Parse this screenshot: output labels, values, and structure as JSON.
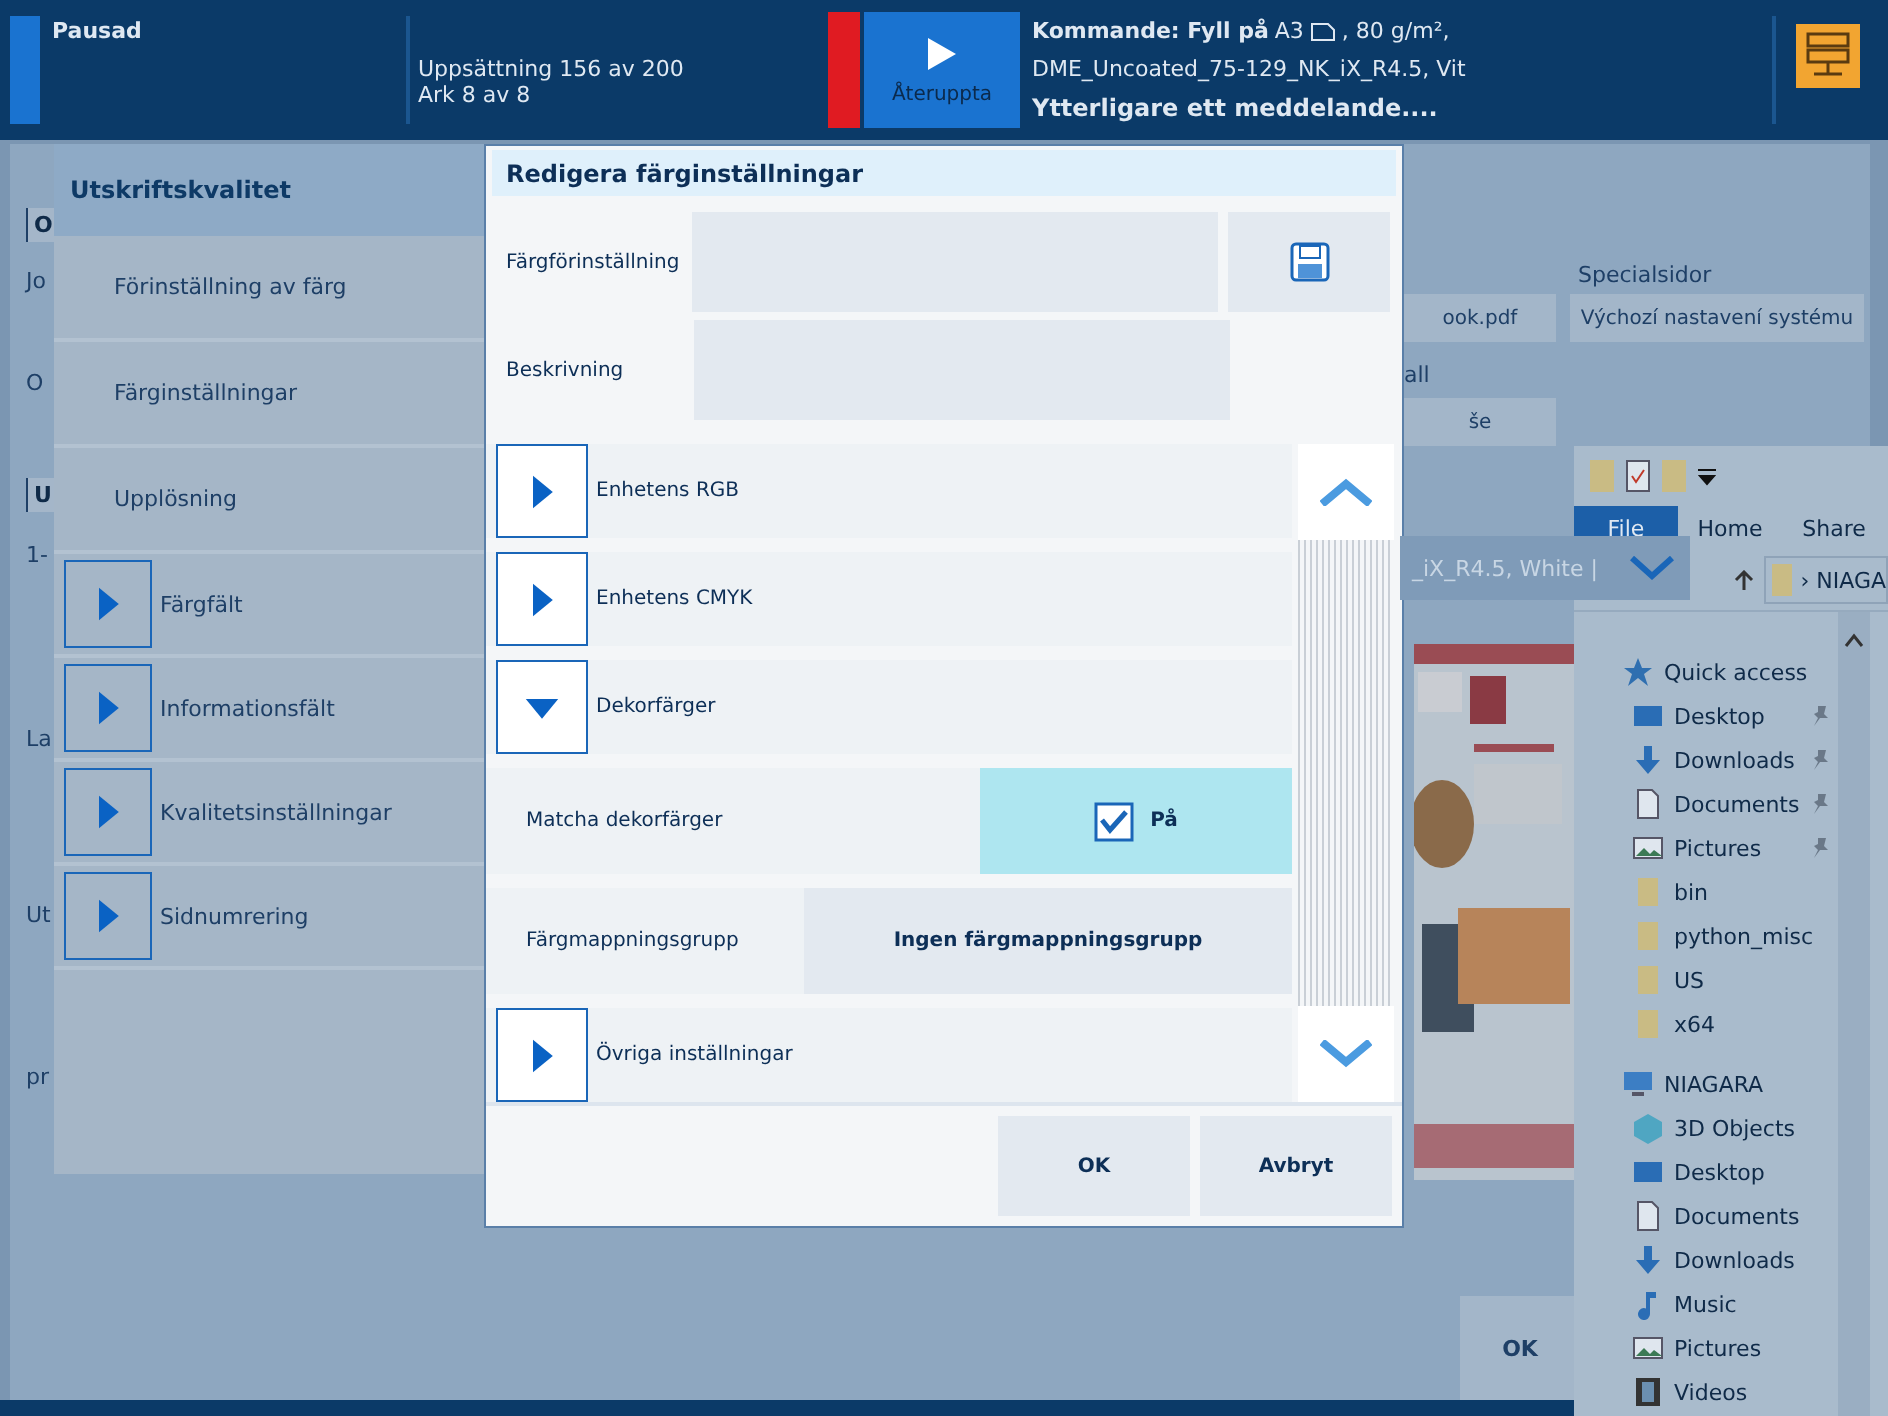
{
  "status_bar": {
    "state": "Pausad",
    "progress_lines": [
      "Uppsättning 156 av 200",
      "Ark 8 av 8"
    ],
    "resume_button": "Återuppta",
    "next_label": "Kommande: Fyll på",
    "next_size": "A3",
    "next_weight": ", 80 g/m²,",
    "next_media": "DME_Uncoated_75-129_NK_iX_R4.5, Vit",
    "message": "Ytterligare ett meddelande...."
  },
  "background": {
    "fragments": [
      {
        "text": "O",
        "kind": "tab"
      },
      {
        "text": "Jo",
        "kind": "label"
      },
      {
        "text": "O",
        "kind": "label"
      },
      {
        "text": "U",
        "kind": "tab"
      },
      {
        "text": "1-",
        "kind": "label"
      },
      {
        "text": "La",
        "kind": "label"
      },
      {
        "text": "Ut",
        "kind": "label"
      },
      {
        "text": "pr",
        "kind": "label"
      }
    ],
    "file_value": "ook.pdf",
    "special_label": "Specialsidor",
    "special_value": "Výchozí nastavení systému",
    "fragment_all": "all",
    "fragment_se": "še",
    "media_dropdown": "_iX_R4.5, White |",
    "ok_button": "OK"
  },
  "quality_panel": {
    "title": "Utskriftskvalitet",
    "items": [
      {
        "label": "Förinställning av färg",
        "kind": "plain"
      },
      {
        "label": "Färginställningar",
        "kind": "plain"
      },
      {
        "label": "Upplösning",
        "kind": "plain"
      },
      {
        "label": "Färgfält",
        "kind": "expander"
      },
      {
        "label": "Informationsfält",
        "kind": "expander"
      },
      {
        "label": "Kvalitetsinställningar",
        "kind": "expander"
      },
      {
        "label": "Sidnumrering",
        "kind": "expander"
      }
    ]
  },
  "dialog": {
    "title": "Redigera färginställningar",
    "preset_label": "Färgförinställning",
    "description_label": "Beskrivning",
    "sections": [
      {
        "label": "Enhetens RGB",
        "expanded": false
      },
      {
        "label": "Enhetens CMYK",
        "expanded": false
      },
      {
        "label": "Dekorfärger",
        "expanded": true,
        "settings": [
          {
            "kind": "toggle",
            "label": "Matcha dekorfärger",
            "value": "På",
            "checked": true
          },
          {
            "kind": "select",
            "label": "Färgmappningsgrupp",
            "value": "Ingen färgmappningsgrupp"
          }
        ]
      },
      {
        "label": "Övriga inställningar",
        "expanded": false
      }
    ],
    "buttons": [
      "OK",
      "Avbryt"
    ]
  },
  "explorer": {
    "tabs": [
      {
        "label": "File",
        "selected": true
      },
      {
        "label": "Home",
        "selected": false
      },
      {
        "label": "Share",
        "selected": false
      }
    ],
    "address_separator": "›",
    "address": "NIAGA",
    "nav": [
      {
        "label": "Quick access",
        "kind": "star",
        "children": [
          {
            "label": "Desktop",
            "kind": "desktop",
            "pinned": true
          },
          {
            "label": "Downloads",
            "kind": "download",
            "pinned": true
          },
          {
            "label": "Documents",
            "kind": "document",
            "pinned": true
          },
          {
            "label": "Pictures",
            "kind": "pictures",
            "pinned": true
          },
          {
            "label": "bin",
            "kind": "folder",
            "pinned": false
          },
          {
            "label": "python_misc",
            "kind": "folder",
            "pinned": false
          },
          {
            "label": "US",
            "kind": "folder",
            "pinned": false
          },
          {
            "label": "x64",
            "kind": "folder",
            "pinned": false
          }
        ]
      },
      {
        "label": "NIAGARA",
        "kind": "computer",
        "children": [
          {
            "label": "3D Objects",
            "kind": "cube",
            "pinned": false
          },
          {
            "label": "Desktop",
            "kind": "desktop",
            "pinned": false
          },
          {
            "label": "Documents",
            "kind": "document",
            "pinned": false
          },
          {
            "label": "Downloads",
            "kind": "download",
            "pinned": false
          },
          {
            "label": "Music",
            "kind": "music",
            "pinned": false
          },
          {
            "label": "Pictures",
            "kind": "pictures",
            "pinned": false
          },
          {
            "label": "Videos",
            "kind": "video",
            "pinned": false
          }
        ]
      }
    ]
  }
}
